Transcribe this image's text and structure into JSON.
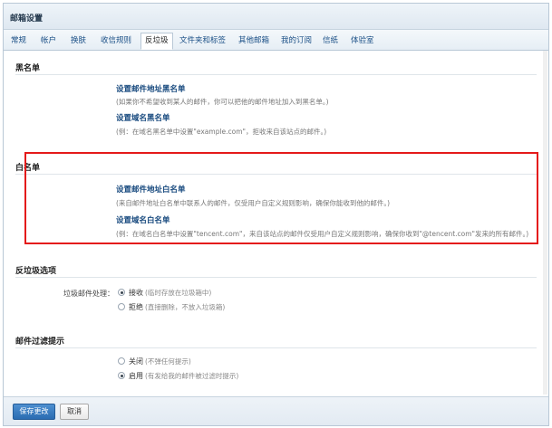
{
  "window": {
    "title": "邮箱设置"
  },
  "tabs": [
    {
      "label": "常规"
    },
    {
      "label": "帐户"
    },
    {
      "label": "换肤"
    },
    {
      "label": "收信规则"
    },
    {
      "label": "反垃圾",
      "active": true
    },
    {
      "label": "文件夹和标签"
    },
    {
      "label": "其他邮箱"
    },
    {
      "label": "我的订阅"
    },
    {
      "label": "信纸"
    },
    {
      "label": "体验室"
    }
  ],
  "blacklist": {
    "title": "黑名单",
    "address_link": "设置邮件地址黑名单",
    "address_desc": "(如果你不希望收到某人的邮件，你可以把他的邮件地址加入到黑名单。)",
    "domain_link": "设置域名黑名单",
    "domain_desc": "(例：在域名黑名单中设置\"example.com\"，拒收来自该站点的邮件。)"
  },
  "whitelist": {
    "title": "白名单",
    "address_link": "设置邮件地址白名单",
    "address_desc": "(来自邮件地址白名单中联系人的邮件，仅受用户自定义规则影响，确保你能收到他的邮件。)",
    "domain_link": "设置域名白名单",
    "domain_desc": "(例：在域名白名单中设置\"tencent.com\"，来自该站点的邮件仅受用户自定义规则影响，确保你收到\"@tencent.com\"发来的所有邮件。)"
  },
  "antispam": {
    "title": "反垃圾选项",
    "field_label": "垃圾邮件处理：",
    "options": [
      {
        "label": "接收",
        "hint": "(临时存放在垃圾箱中)",
        "checked": true
      },
      {
        "label": "拒绝",
        "hint": "(直接删除，不放入垃圾箱)",
        "checked": false
      }
    ]
  },
  "filter_notice": {
    "title": "邮件过滤提示",
    "options": [
      {
        "label": "关闭",
        "hint": "(不弹任何提示)",
        "checked": false
      },
      {
        "label": "启用",
        "hint": "(有发给我的邮件被过滤时提示)",
        "checked": true
      }
    ]
  },
  "footer": {
    "save_label": "保存更改",
    "cancel_label": "取消"
  }
}
